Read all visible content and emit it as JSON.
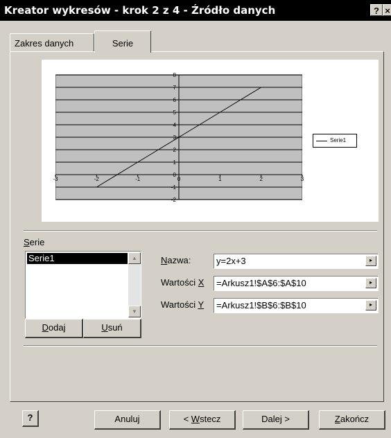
{
  "window": {
    "title": "Kreator wykresów - krok 2 z 4 - Źródło danych",
    "help_glyph": "?",
    "close_glyph": "×"
  },
  "tabs": [
    {
      "label": "Zakres danych"
    },
    {
      "label": "Serie"
    }
  ],
  "chart_data": {
    "type": "line",
    "series": [
      {
        "name": "Serie1",
        "x": [
          -2,
          -1,
          0,
          1,
          2
        ],
        "y": [
          -1,
          1,
          3,
          5,
          7
        ]
      }
    ],
    "xlim": [
      -3,
      3
    ],
    "ylim": [
      -2,
      8
    ],
    "x_ticks": [
      "-3",
      "-2",
      "-1",
      "0",
      "1",
      "2",
      "3"
    ],
    "y_ticks": [
      "-2",
      "-1",
      "0",
      "1",
      "2",
      "3",
      "4",
      "5",
      "6",
      "7",
      "8"
    ],
    "grid": true,
    "legend_position": "right",
    "plot_bg": "#c0c0c0",
    "line_color": "#000000"
  },
  "series_section": {
    "label_underlined": "S",
    "label_rest": "erie",
    "items": [
      "Serie1"
    ],
    "add_button_underlined": "D",
    "add_button_rest": "odaj",
    "remove_button_underlined": "U",
    "remove_button_rest": "suń"
  },
  "fields": {
    "name_label_underlined": "N",
    "name_label_rest": "azwa:",
    "name_value": "y=2x+3",
    "xvals_label_prefix": "Wartości ",
    "xvals_label_underlined": "X",
    "xvals_value": "=Arkusz1!$A$6:$A$10",
    "yvals_label_prefix": "Wartości ",
    "yvals_label_underlined": "Y",
    "yvals_value": "=Arkusz1!$B$6:$B$10"
  },
  "footer": {
    "help_icon_glyph": "?",
    "cancel": "Anuluj",
    "back_prefix": "< ",
    "back_underlined": "W",
    "back_rest": "stecz",
    "next": "Dalej >",
    "finish_underlined": "Z",
    "finish_rest": "akończ"
  }
}
